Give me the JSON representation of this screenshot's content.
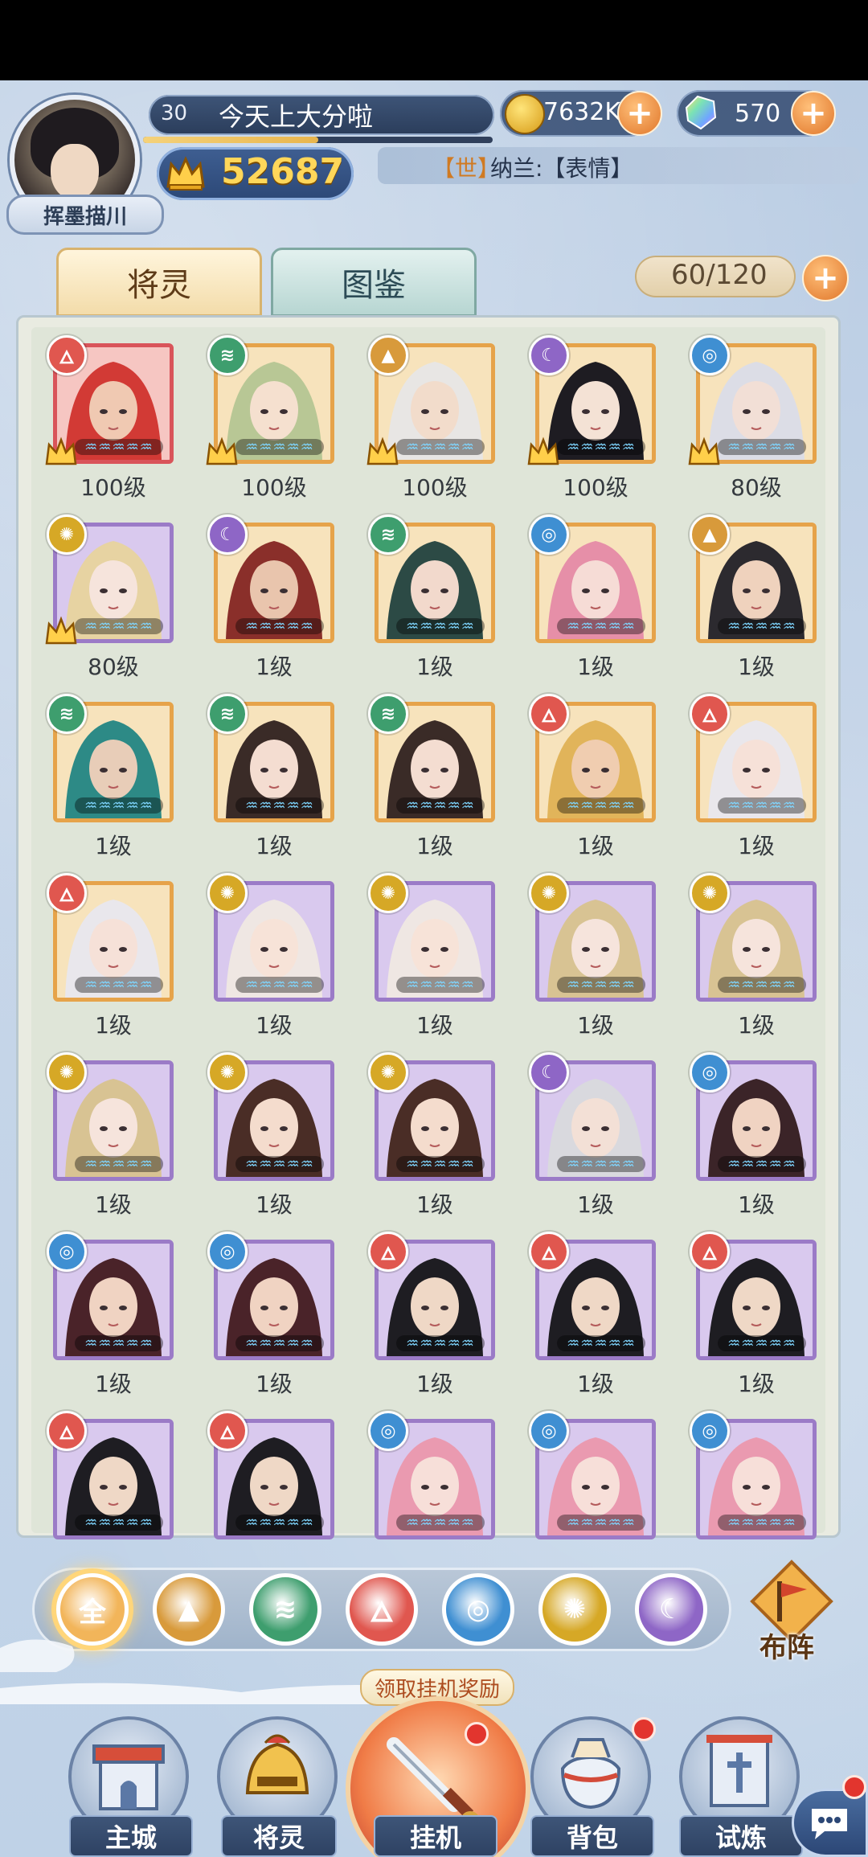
{
  "player": {
    "name": "挥墨描川",
    "level": "30",
    "nickname": "今天上大分啦",
    "power": "52687",
    "exp_fraction": 0.5
  },
  "currency": {
    "coins": "7632K",
    "gems": "570",
    "plus_symbol": "+"
  },
  "chat": {
    "prefix": "【世】",
    "message": "纳兰:【表情】"
  },
  "tabs": [
    {
      "label": "将灵",
      "active": true
    },
    {
      "label": "图鉴",
      "active": false
    }
  ],
  "capacity": "60/120",
  "elements": {
    "fire": {
      "icon": "fire-icon",
      "color": "#e0574f",
      "glyph": "🜂"
    },
    "wind": {
      "icon": "wind-icon",
      "color": "#3e9e6e",
      "glyph": "≋"
    },
    "mountain": {
      "icon": "mountain-icon",
      "color": "#d89a3b",
      "glyph": "▲"
    },
    "moon": {
      "icon": "moon-icon",
      "color": "#8e66c6",
      "glyph": "☾"
    },
    "water": {
      "icon": "water-icon",
      "color": "#3f8fd2",
      "glyph": "◎"
    },
    "sun": {
      "icon": "sun-icon",
      "color": "#d6a826",
      "glyph": "✺"
    }
  },
  "heroes": [
    {
      "level": "100级",
      "element": "fire",
      "rarity": "red",
      "medal": true,
      "hair": "#d23a35",
      "skin": "#f0c9b2"
    },
    {
      "level": "100级",
      "element": "wind",
      "rarity": "gold",
      "medal": true,
      "hair": "#b8c795",
      "skin": "#f5e0cf"
    },
    {
      "level": "100级",
      "element": "mountain",
      "rarity": "gold",
      "medal": true,
      "hair": "#e8e6e4",
      "skin": "#f2dccb"
    },
    {
      "level": "100级",
      "element": "moon",
      "rarity": "gold",
      "medal": true,
      "hair": "#1e1c22",
      "skin": "#f4e2d5"
    },
    {
      "level": "80级",
      "element": "water",
      "rarity": "gold",
      "medal": true,
      "hair": "#dcdde6",
      "skin": "#f2dfd6"
    },
    {
      "level": "80级",
      "element": "sun",
      "rarity": "purple",
      "medal": true,
      "hair": "#e7d3a2",
      "skin": "#f6e4dc"
    },
    {
      "level": "1级",
      "element": "moon",
      "rarity": "gold",
      "medal": false,
      "hair": "#8a2f2a",
      "skin": "#e9c5ad"
    },
    {
      "level": "1级",
      "element": "wind",
      "rarity": "gold",
      "medal": false,
      "hair": "#2c4a45",
      "skin": "#f2d9cc"
    },
    {
      "level": "1级",
      "element": "water",
      "rarity": "gold",
      "medal": false,
      "hair": "#e68fa8",
      "skin": "#f6dcd6"
    },
    {
      "level": "1级",
      "element": "mountain",
      "rarity": "gold",
      "medal": false,
      "hair": "#2c2a2f",
      "skin": "#efd2bd"
    },
    {
      "level": "1级",
      "element": "wind",
      "rarity": "gold",
      "medal": false,
      "hair": "#2d8a86",
      "skin": "#e8cdb8"
    },
    {
      "level": "1级",
      "element": "wind",
      "rarity": "gold",
      "medal": false,
      "hair": "#3a2b27",
      "skin": "#f4ddd1"
    },
    {
      "level": "1级",
      "element": "wind",
      "rarity": "gold",
      "medal": false,
      "hair": "#3a2b27",
      "skin": "#f4ddd1"
    },
    {
      "level": "1级",
      "element": "fire",
      "rarity": "gold",
      "medal": false,
      "hair": "#e1b45a",
      "skin": "#f0cdb0"
    },
    {
      "level": "1级",
      "element": "fire",
      "rarity": "gold",
      "medal": false,
      "hair": "#e9e7ec",
      "skin": "#f6e1d8"
    },
    {
      "level": "1级",
      "element": "fire",
      "rarity": "gold",
      "medal": false,
      "hair": "#e9e7ec",
      "skin": "#f6e1d8"
    },
    {
      "level": "1级",
      "element": "sun",
      "rarity": "purple",
      "medal": false,
      "hair": "#efe7e3",
      "skin": "#f7e3d8"
    },
    {
      "level": "1级",
      "element": "sun",
      "rarity": "purple",
      "medal": false,
      "hair": "#efe7e3",
      "skin": "#f7e3d8"
    },
    {
      "level": "1级",
      "element": "sun",
      "rarity": "purple",
      "medal": false,
      "hair": "#d8c393",
      "skin": "#f6e4dc"
    },
    {
      "level": "1级",
      "element": "sun",
      "rarity": "purple",
      "medal": false,
      "hair": "#d8c393",
      "skin": "#f6e4dc"
    },
    {
      "level": "1级",
      "element": "sun",
      "rarity": "purple",
      "medal": false,
      "hair": "#d8c393",
      "skin": "#f6e4dc"
    },
    {
      "level": "1级",
      "element": "sun",
      "rarity": "purple",
      "medal": false,
      "hair": "#4a2d26",
      "skin": "#f4dccd"
    },
    {
      "level": "1级",
      "element": "sun",
      "rarity": "purple",
      "medal": false,
      "hair": "#4a2d26",
      "skin": "#f4dccd"
    },
    {
      "level": "1级",
      "element": "moon",
      "rarity": "purple",
      "medal": false,
      "hair": "#d9d9de",
      "skin": "#f3e0d6"
    },
    {
      "level": "1级",
      "element": "water",
      "rarity": "purple",
      "medal": false,
      "hair": "#3b2428",
      "skin": "#f0d3c2"
    },
    {
      "level": "1级",
      "element": "water",
      "rarity": "purple",
      "medal": false,
      "hair": "#4a2329",
      "skin": "#f0d3c2"
    },
    {
      "level": "1级",
      "element": "water",
      "rarity": "purple",
      "medal": false,
      "hair": "#4a2329",
      "skin": "#f0d3c2"
    },
    {
      "level": "1级",
      "element": "fire",
      "rarity": "purple",
      "medal": false,
      "hair": "#1e1d22",
      "skin": "#efd8c6"
    },
    {
      "level": "1级",
      "element": "fire",
      "rarity": "purple",
      "medal": false,
      "hair": "#1e1d22",
      "skin": "#efd8c6"
    },
    {
      "level": "1级",
      "element": "fire",
      "rarity": "purple",
      "medal": false,
      "hair": "#1e1d22",
      "skin": "#efd8c6"
    },
    {
      "level": "",
      "element": "fire",
      "rarity": "purple",
      "medal": false,
      "hair": "#1e1d22",
      "skin": "#efd8c6"
    },
    {
      "level": "",
      "element": "fire",
      "rarity": "purple",
      "medal": false,
      "hair": "#1e1d22",
      "skin": "#efd8c6"
    },
    {
      "level": "",
      "element": "water",
      "rarity": "purple",
      "medal": false,
      "hair": "#ea9ab0",
      "skin": "#f7dfd9"
    },
    {
      "level": "",
      "element": "water",
      "rarity": "purple",
      "medal": false,
      "hair": "#ea9ab0",
      "skin": "#f7dfd9"
    },
    {
      "level": "",
      "element": "water",
      "rarity": "purple",
      "medal": false,
      "hair": "#ea9ab0",
      "skin": "#f7dfd9"
    }
  ],
  "filters": [
    {
      "label": "全",
      "key": "all",
      "color": "#f2b55a",
      "active": true
    },
    {
      "label": "",
      "key": "mountain",
      "color": "#d89a3b",
      "active": false
    },
    {
      "label": "",
      "key": "wind",
      "color": "#3e9e6e",
      "active": false
    },
    {
      "label": "",
      "key": "fire",
      "color": "#e0574f",
      "active": false
    },
    {
      "label": "",
      "key": "water",
      "color": "#3f8fd2",
      "active": false
    },
    {
      "label": "",
      "key": "sun",
      "color": "#d6a826",
      "active": false
    },
    {
      "label": "",
      "key": "moon",
      "color": "#8e66c6",
      "active": false
    }
  ],
  "formation_label": "布阵",
  "claim_label": "领取挂机奖励",
  "nav": [
    {
      "label": "主城",
      "icon": "castle-icon"
    },
    {
      "label": "将灵",
      "icon": "helmet-icon"
    },
    {
      "label": "挂机",
      "icon": "sword-icon"
    },
    {
      "label": "背包",
      "icon": "bag-icon"
    },
    {
      "label": "试炼",
      "icon": "banner-icon"
    }
  ]
}
